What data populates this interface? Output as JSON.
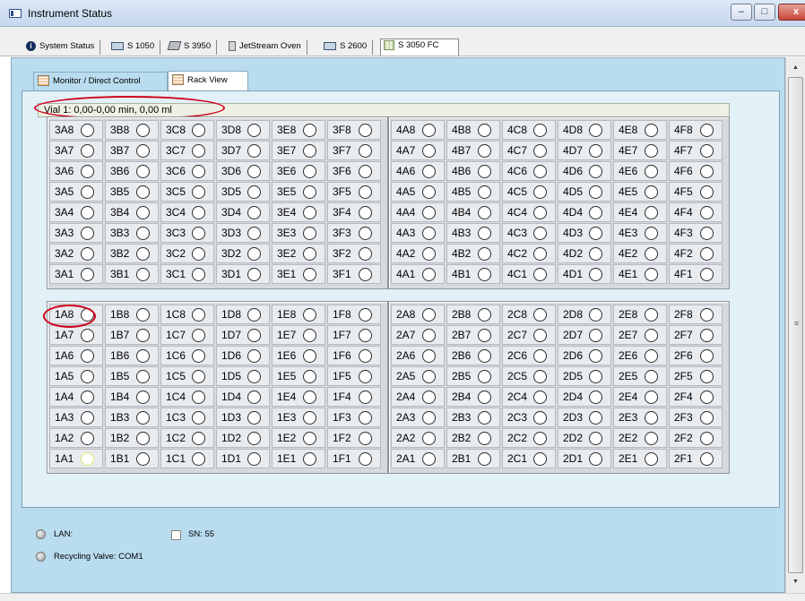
{
  "window": {
    "title": "Instrument Status",
    "minimize": "–",
    "maximize": "□",
    "close": "x"
  },
  "device_tabs": [
    {
      "label": "System Status",
      "icon": "info-icon"
    },
    {
      "label": "S 1050",
      "icon": "device-icon"
    },
    {
      "label": "S 3950",
      "icon": "device-icon"
    },
    {
      "label": "JetStream Oven",
      "icon": "oven-icon"
    },
    {
      "label": "S 2600",
      "icon": "device-icon"
    },
    {
      "label": "S 3050 FC",
      "icon": "rack-icon",
      "active": true
    }
  ],
  "sub_tabs": [
    {
      "label": "Monitor / Direct Control"
    },
    {
      "label": "Rack View",
      "active": true
    }
  ],
  "vial_info": "Vial 1: 0,00-0,00 min, 0,00 ml",
  "racks": [
    {
      "prefix": "3",
      "cols": [
        "A",
        "B",
        "C",
        "D",
        "E",
        "F"
      ],
      "rows": [
        8,
        7,
        6,
        5,
        4,
        3,
        2,
        1
      ]
    },
    {
      "prefix": "4",
      "cols": [
        "A",
        "B",
        "C",
        "D",
        "E",
        "F"
      ],
      "rows": [
        8,
        7,
        6,
        5,
        4,
        3,
        2,
        1
      ]
    },
    {
      "prefix": "1",
      "cols": [
        "A",
        "B",
        "C",
        "D",
        "E",
        "F"
      ],
      "rows": [
        8,
        7,
        6,
        5,
        4,
        3,
        2,
        1
      ],
      "highlight": "1A1"
    },
    {
      "prefix": "2",
      "cols": [
        "A",
        "B",
        "C",
        "D",
        "E",
        "F"
      ],
      "rows": [
        8,
        7,
        6,
        5,
        4,
        3,
        2,
        1
      ]
    }
  ],
  "status": {
    "lan_label": "LAN:",
    "sn_label": "SN: 55",
    "recycling_label": "Recycling Valve: COM1"
  },
  "colors": {
    "panel_bg": "#b9dcef",
    "annotation": "#d0021b"
  }
}
